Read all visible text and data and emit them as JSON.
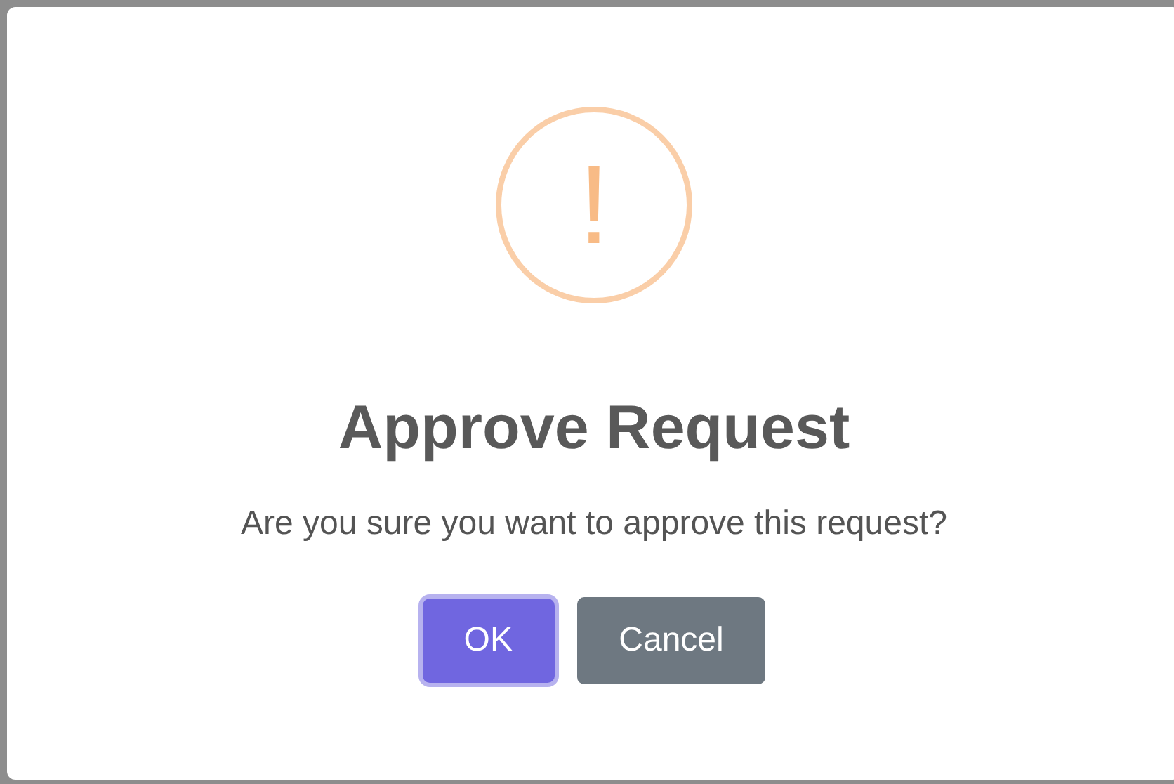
{
  "dialog": {
    "icon": {
      "glyph": "!"
    },
    "title": "Approve Request",
    "message": "Are you sure you want to approve this request?",
    "buttons": [
      {
        "label": "OK",
        "kind": "confirm",
        "focused": true
      },
      {
        "label": "Cancel",
        "kind": "cancel",
        "focused": false
      }
    ]
  }
}
